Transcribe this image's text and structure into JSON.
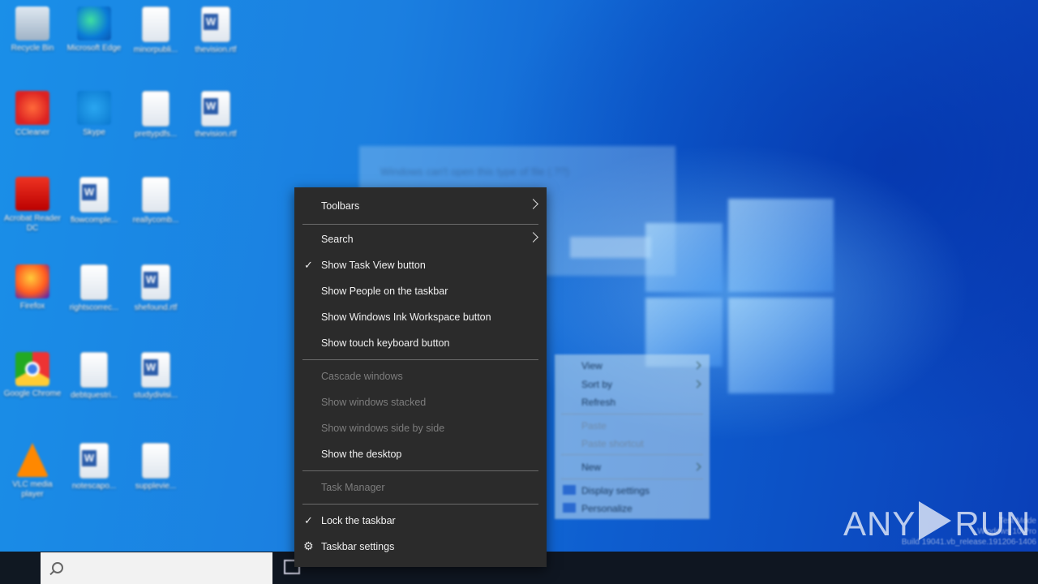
{
  "desktop": {
    "icons": [
      {
        "label": "Recycle Bin",
        "icon": "recycle-bin-icon"
      },
      {
        "label": "Microsoft Edge",
        "icon": "edge-icon"
      },
      {
        "label": "minorpubli...",
        "icon": "document-icon"
      },
      {
        "label": "thevision.rtf",
        "icon": "word-icon"
      },
      {
        "label": "CCleaner",
        "icon": "ccleaner-icon"
      },
      {
        "label": "Skype",
        "icon": "skype-icon"
      },
      {
        "label": "prettypdfs...",
        "icon": "document-icon"
      },
      {
        "label": "thevision.rtf",
        "icon": "word-icon"
      },
      {
        "label": "Acrobat Reader DC",
        "icon": "acrobat-icon"
      },
      {
        "label": "flowcomple...",
        "icon": "word-icon"
      },
      {
        "label": "reallycomb...",
        "icon": "document-icon"
      },
      {
        "label": "Firefox",
        "icon": "firefox-icon"
      },
      {
        "label": "rightscorrec...",
        "icon": "document-icon"
      },
      {
        "label": "shefound.rtf",
        "icon": "word-icon"
      },
      {
        "label": "Google Chrome",
        "icon": "chrome-icon"
      },
      {
        "label": "debtquestri...",
        "icon": "document-icon"
      },
      {
        "label": "studydivisi...",
        "icon": "word-icon"
      },
      {
        "label": "VLC media player",
        "icon": "vlc-icon"
      },
      {
        "label": "notescapo...",
        "icon": "word-icon"
      },
      {
        "label": "supplevie...",
        "icon": "document-icon"
      }
    ],
    "ghost_dialog_text": "Windows can't open this type of file (.??)"
  },
  "taskbar_menu": {
    "toolbars": "Toolbars",
    "search": "Search",
    "show_task_view": "Show Task View button",
    "show_people": "Show People on the taskbar",
    "show_ink": "Show Windows Ink Workspace button",
    "show_touch_keyboard": "Show touch keyboard button",
    "cascade": "Cascade windows",
    "stacked": "Show windows stacked",
    "side_by_side": "Show windows side by side",
    "show_desktop": "Show the desktop",
    "task_manager": "Task Manager",
    "lock_taskbar": "Lock the taskbar",
    "taskbar_settings": "Taskbar settings",
    "check_glyph": "✓",
    "gear_glyph": "⚙"
  },
  "desktop_menu": {
    "view": "View",
    "sort_by": "Sort by",
    "refresh": "Refresh",
    "paste": "Paste",
    "paste_shortcut": "Paste shortcut",
    "new": "New",
    "display_settings": "Display settings",
    "personalize": "Personalize"
  },
  "watermark": {
    "left": "ANY",
    "right": "RUN",
    "info_line1": "Test Mode",
    "info_line2": "Windows 10 Pro",
    "info_line3": "Build 19041.vb_release.191206-1406"
  },
  "colors": {
    "menu_bg": "#2b2b2b",
    "taskbar_bg": "#0f1621",
    "desktop_accent": "#1b7fe0"
  }
}
